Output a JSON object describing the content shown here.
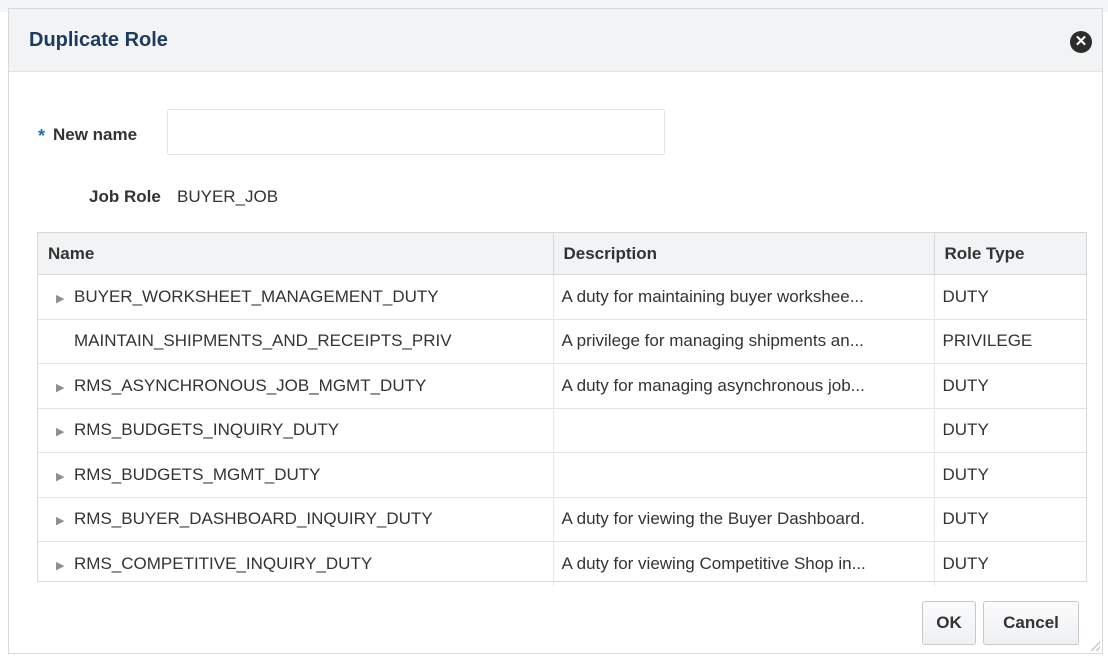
{
  "dialog": {
    "title": "Duplicate Role",
    "close_icon": "close-circle-icon"
  },
  "form": {
    "required_marker": "*",
    "new_name_label": "New name",
    "new_name_value": "",
    "job_role_label": "Job Role",
    "job_role_value": "BUYER_JOB"
  },
  "table": {
    "headers": {
      "name": "Name",
      "description": "Description",
      "role_type": "Role Type"
    },
    "rows": [
      {
        "expandable": true,
        "name": "BUYER_WORKSHEET_MANAGEMENT_DUTY",
        "description": "A duty for maintaining buyer workshee...",
        "role_type": "DUTY"
      },
      {
        "expandable": false,
        "name": "MAINTAIN_SHIPMENTS_AND_RECEIPTS_PRIV",
        "description": "A privilege for managing shipments an...",
        "role_type": "PRIVILEGE"
      },
      {
        "expandable": true,
        "name": "RMS_ASYNCHRONOUS_JOB_MGMT_DUTY",
        "description": "A duty for managing asynchronous job...",
        "role_type": "DUTY"
      },
      {
        "expandable": true,
        "name": "RMS_BUDGETS_INQUIRY_DUTY",
        "description": "",
        "role_type": "DUTY"
      },
      {
        "expandable": true,
        "name": "RMS_BUDGETS_MGMT_DUTY",
        "description": "",
        "role_type": "DUTY"
      },
      {
        "expandable": true,
        "name": "RMS_BUYER_DASHBOARD_INQUIRY_DUTY",
        "description": "A duty for viewing the Buyer Dashboard.",
        "role_type": "DUTY"
      },
      {
        "expandable": true,
        "name": "RMS_COMPETITIVE_INQUIRY_DUTY",
        "description": "A duty for viewing Competitive Shop in...",
        "role_type": "DUTY"
      }
    ]
  },
  "buttons": {
    "ok": "OK",
    "cancel": "Cancel"
  },
  "colors": {
    "title": "#1e3a5f",
    "required": "#1f6fb2",
    "header_bg": "#f1f3f4"
  }
}
